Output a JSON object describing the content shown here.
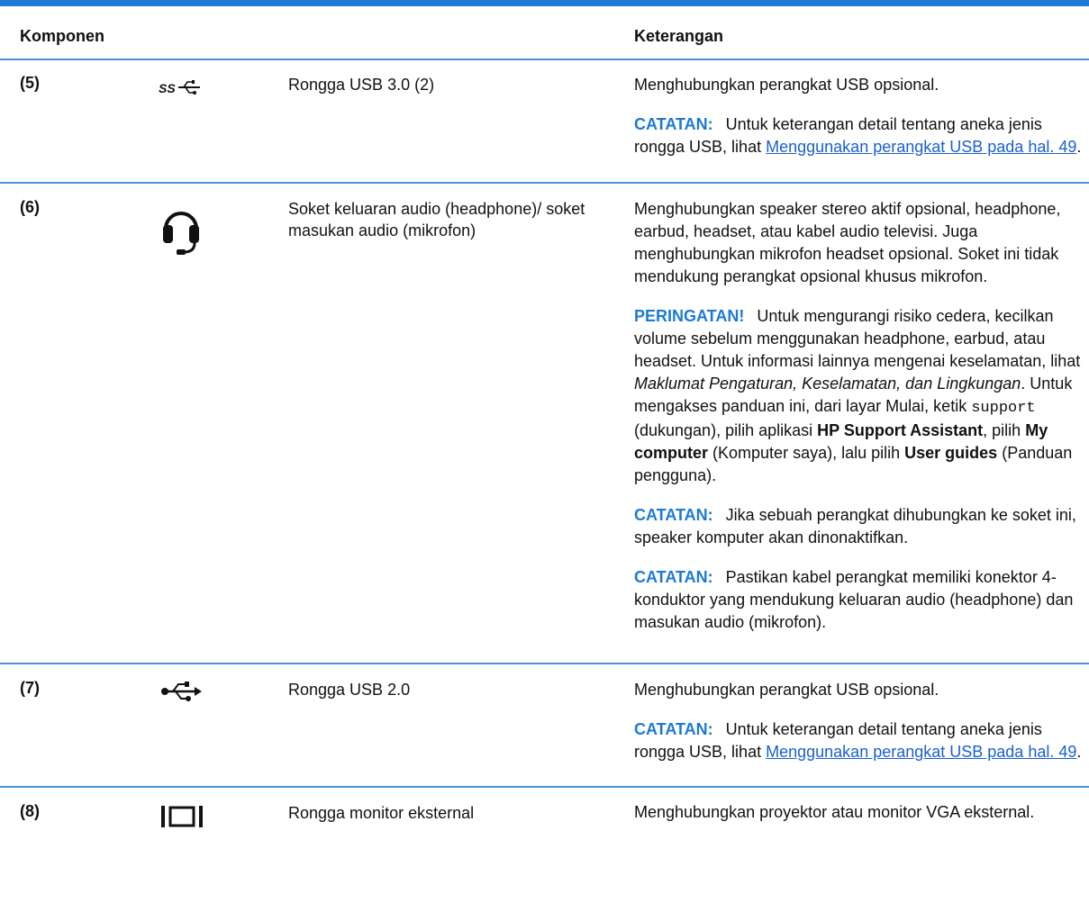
{
  "header": {
    "col_component": "Komponen",
    "col_description": "Keterangan"
  },
  "rows": [
    {
      "num": "(5)",
      "icon": "usb-superspeed-icon",
      "component": "Rongga USB 3.0 (2)",
      "desc_main": "Menghubungkan perangkat USB opsional.",
      "note_label": "CATATAN:",
      "note_text": "Untuk keterangan detail tentang aneka jenis rongga USB, lihat",
      "note_link": "Menggunakan perangkat USB pada hal. 49"
    },
    {
      "num": "(6)",
      "icon": "headset-icon",
      "component": "Soket keluaran audio (headphone)/ soket masukan audio (mikrofon)",
      "desc_main": "Menghubungkan speaker stereo aktif opsional, headphone, earbud, headset, atau kabel audio televisi. Juga menghubungkan mikrofon headset opsional. Soket ini tidak mendukung perangkat opsional khusus mikrofon.",
      "warning_label": "PERINGATAN!",
      "warning_text_1": "Untuk mengurangi risiko cedera, kecilkan volume sebelum menggunakan headphone, earbud, atau headset. Untuk informasi lainnya mengenai keselamatan, lihat",
      "warning_italic": "Maklumat Pengaturan, Keselamatan, dan Lingkungan",
      "warning_text_2": ". Untuk mengakses panduan ini, dari layar Mulai, ketik",
      "warning_code": "support",
      "warning_text_3": "(dukungan), pilih aplikasi",
      "warning_bold_1": "HP Support Assistant",
      "warning_text_4": ", pilih",
      "warning_bold_2": "My computer",
      "warning_text_5": "(Komputer saya), lalu pilih",
      "warning_bold_3": "User guides",
      "warning_text_6": "(Panduan pengguna).",
      "note1_label": "CATATAN:",
      "note1_text": "Jika sebuah perangkat dihubungkan ke soket ini, speaker komputer akan dinonaktifkan.",
      "note2_label": "CATATAN:",
      "note2_text": "Pastikan kabel perangkat memiliki konektor 4-konduktor yang mendukung keluaran audio (headphone) dan masukan audio (mikrofon)."
    },
    {
      "num": "(7)",
      "icon": "usb-icon",
      "component": "Rongga USB 2.0",
      "desc_main": "Menghubungkan perangkat USB opsional.",
      "note_label": "CATATAN:",
      "note_text": "Untuk keterangan detail tentang aneka jenis rongga USB, lihat",
      "note_link": "Menggunakan perangkat USB pada hal. 49"
    },
    {
      "num": "(8)",
      "icon": "external-monitor-icon",
      "component": "Rongga monitor eksternal",
      "desc_main": "Menghubungkan proyektor atau monitor VGA eksternal."
    }
  ]
}
